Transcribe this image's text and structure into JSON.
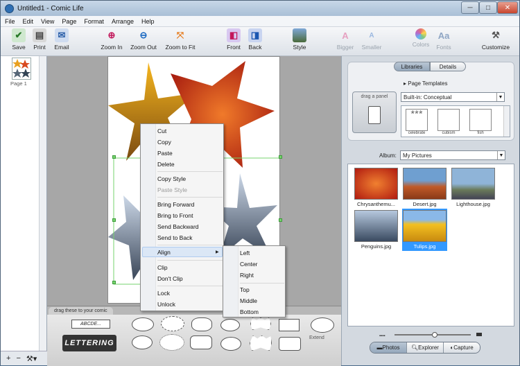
{
  "window": {
    "title": "Untitled1 - Comic Life"
  },
  "menubar": {
    "items": [
      "File",
      "Edit",
      "View",
      "Page",
      "Format",
      "Arrange",
      "Help"
    ]
  },
  "toolbar": {
    "save": "Save",
    "print": "Print",
    "email": "Email",
    "zoom_in": "Zoom In",
    "zoom_out": "Zoom Out",
    "zoom_fit": "Zoom to Fit",
    "front": "Front",
    "back": "Back",
    "style": "Style",
    "bigger": "Bigger",
    "smaller": "Smaller",
    "colors": "Colors",
    "fonts": "Fonts",
    "customize": "Customize"
  },
  "pages": {
    "label": "Page 1"
  },
  "tray": {
    "tab_label": "drag these to your comic",
    "titlebox": "ABCDE...",
    "lettering": "LETTERING",
    "extend": "Extend"
  },
  "right": {
    "tab_libraries": "Libraries",
    "tab_details": "Details",
    "page_templates": "Page Templates",
    "template_combo": "Built-in: Conceptual",
    "drag_panel": "drag a panel",
    "template_labels": [
      "celebrate",
      "cubism",
      "fish"
    ],
    "album_label": "Album:",
    "album_combo": "My Pictures",
    "photos": [
      "Chrysanthemu...",
      "Desert.jpg",
      "Lighthouse.jpg",
      "Penguins.jpg",
      "Tulips.jpg"
    ],
    "bottom_tabs": {
      "photos": "Photos",
      "explorer": "Explorer",
      "capture": "Capture"
    }
  },
  "context_menu": {
    "items": [
      "Cut",
      "Copy",
      "Paste",
      "Delete",
      "Copy Style",
      "Paste Style",
      "Bring Forward",
      "Bring to Front",
      "Send Backward",
      "Send to Back",
      "Align",
      "Clip",
      "Don't Clip",
      "Lock",
      "Unlock"
    ],
    "submenu_arrow": "▶"
  },
  "align_submenu": {
    "items": [
      "Left",
      "Center",
      "Right",
      "Top",
      "Middle",
      "Bottom"
    ]
  },
  "colors": {
    "accent": "#3399ff",
    "titlebar": "#b4c8dc"
  }
}
